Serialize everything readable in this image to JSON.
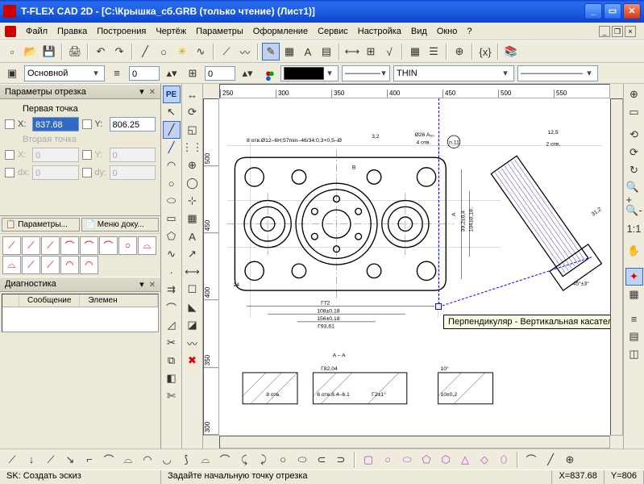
{
  "title": "T-FLEX CAD 2D - [C:\\Крышка_сб.GRB (только чтение) (Лист1)]",
  "menus": [
    "Файл",
    "Правка",
    "Построения",
    "Чертёж",
    "Параметры",
    "Оформление",
    "Сервис",
    "Настройка",
    "Вид",
    "Окно",
    "?"
  ],
  "layer": {
    "name": "Основной"
  },
  "props": {
    "level": "0",
    "priority": "0",
    "line_style": "————",
    "line_type": "THIN",
    "end": "———————"
  },
  "panel": {
    "title": "Параметры отрезка",
    "section1": "Первая точка",
    "x_lbl": "X:",
    "x_val": "837.68",
    "y_lbl": "Y:",
    "y_val": "806.25",
    "section2": "Вторая точка",
    "x2_lbl": "X:",
    "x2_val": "0",
    "y2_lbl": "Y:",
    "y2_val": "0",
    "dx_lbl": "dx:",
    "dx_val": "0",
    "dy_lbl": "dy:",
    "dy_val": "0",
    "tab1": "Параметры...",
    "tab2": "Меню доку..."
  },
  "diag": {
    "title": "Диагностика",
    "col1": "Сообщение",
    "col2": "Элемен"
  },
  "tooltip": "Перпендикуляр - Вертикальная касательная",
  "status": {
    "left": "SK: Создать эскиз",
    "center": "Задайте начальную точку отрезка",
    "x_lbl": "X=",
    "x_val": "837.68",
    "y_lbl": "Y=",
    "y_val": "806"
  },
  "ruler_h": [
    "250",
    "300",
    "350",
    "400",
    "450",
    "500",
    "550"
  ],
  "ruler_v": [
    "500",
    "450",
    "400",
    "350",
    "300"
  ],
  "drawing": {
    "section_label": "A – A",
    "dim_top": "8 отв.Ø12–6Н;57min–46/34:0,3+0,5–Ø",
    "dim_32": "3,2",
    "dim_n26": "Ø26 A₆₀",
    "dim_4min": "4 отв.",
    "ball_n11": "n.11",
    "dim_125": "12,5",
    "dim_2min": "2 отв.",
    "dim_45": "45°±3°",
    "dim_312": "31,2",
    "dim_39": "39,2±0,4",
    "dim_104": "104±0,18",
    "dim_b": "B",
    "dim_a": "A",
    "dim_24": "24",
    "dim_f72": "Г72",
    "dim_108": "108±0,18",
    "dim_156": "156±0,18",
    "dim_f936": "Г93,61",
    "dim_10": "10°",
    "dim_small1": "8 отв.",
    "dim_small2": "Г82,04",
    "dim_small3": "6 отв.8.4–6.1",
    "dim_small4": "Г2±1°",
    "dim_small5": "10±0,2"
  }
}
